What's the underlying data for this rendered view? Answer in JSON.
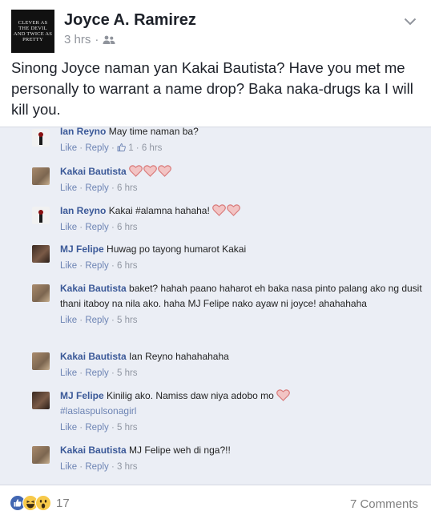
{
  "post": {
    "avatar_text": "CLEVER AS THE DEVIL AND TWICE AS PRETTY",
    "author": "Joyce A. Ramirez",
    "time": "3 hrs",
    "separator": "·",
    "audience_icon": "friends-icon",
    "menu_icon": "chevron-down-icon",
    "text": "Sinong Joyce naman yan Kakai Bautista? Have you met me personally to warrant a name drop? Baka naka-drugs ka I will kill you."
  },
  "comments": [
    {
      "name": "Ian Reyno",
      "text": "May time naman ba?",
      "like": "Like",
      "reply": "Reply",
      "likes": "1",
      "time": "6 hrs",
      "avatar": "ian"
    },
    {
      "name": "Kakai Bautista",
      "text": "",
      "emoji": "three-hearts",
      "like": "Like",
      "reply": "Reply",
      "time": "6 hrs",
      "avatar": "kakai"
    },
    {
      "name": "Ian Reyno",
      "text": "Kakai #alamna hahaha!",
      "emoji": "two-hearts",
      "like": "Like",
      "reply": "Reply",
      "time": "6 hrs",
      "avatar": "ian"
    },
    {
      "name": "MJ Felipe",
      "text": "Huwag po tayong humarot Kakai",
      "like": "Like",
      "reply": "Reply",
      "time": "6 hrs",
      "avatar": "mj"
    },
    {
      "name": "Kakai Bautista",
      "text": "baket? hahah paano haharot eh baka nasa pinto palang ako ng dusit thani itaboy na nila ako. haha MJ Felipe nako ayaw ni joyce! ahahahaha",
      "like": "Like",
      "reply": "Reply",
      "time": "5 hrs",
      "avatar": "kakai"
    },
    {
      "name": "Kakai Bautista",
      "text": "Ian Reyno hahahahaha",
      "like": "Like",
      "reply": "Reply",
      "time": "5 hrs",
      "avatar": "kakai"
    },
    {
      "name": "MJ Felipe",
      "text": "Kinilig ako. Namiss daw niya adobo mo",
      "text2": "#laslaspulsonagirl",
      "emoji": "one-heart",
      "like": "Like",
      "reply": "Reply",
      "time": "5 hrs",
      "avatar": "mj"
    },
    {
      "name": "Kakai Bautista",
      "text": "MJ Felipe weh di nga?!!",
      "like": "Like",
      "reply": "Reply",
      "time": "3 hrs",
      "avatar": "kakai"
    }
  ],
  "footer": {
    "reaction_icons": [
      "like-icon",
      "haha-icon",
      "wow-icon"
    ],
    "reaction_count": "17",
    "comments_label": "7 Comments"
  },
  "colors": {
    "name_link": "#3b5998",
    "heart": "#e8a3a3",
    "like_blue": "#4267b2",
    "reaction_yellow": "#f7c94a"
  }
}
